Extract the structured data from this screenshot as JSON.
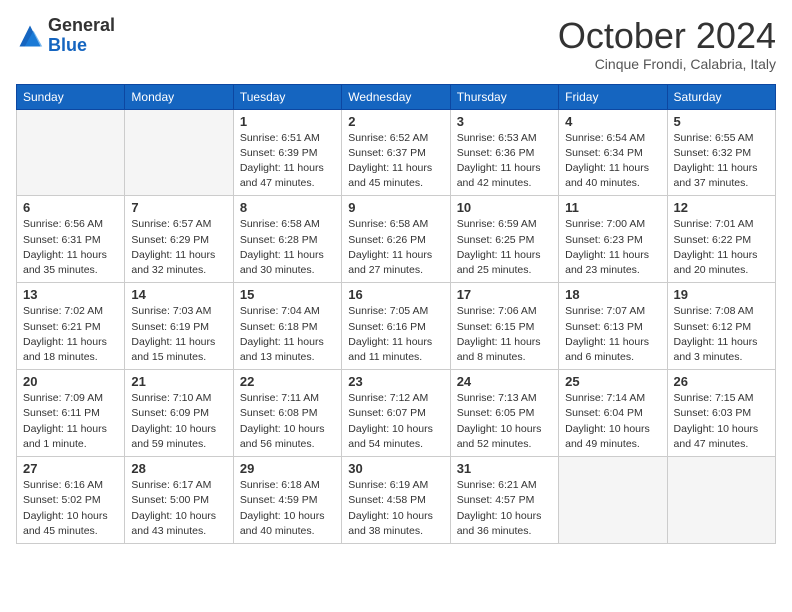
{
  "logo": {
    "line1": "General",
    "line2": "Blue"
  },
  "header": {
    "month": "October 2024",
    "location": "Cinque Frondi, Calabria, Italy"
  },
  "weekdays": [
    "Sunday",
    "Monday",
    "Tuesday",
    "Wednesday",
    "Thursday",
    "Friday",
    "Saturday"
  ],
  "weeks": [
    [
      {
        "day": "",
        "info": ""
      },
      {
        "day": "",
        "info": ""
      },
      {
        "day": "1",
        "info": "Sunrise: 6:51 AM\nSunset: 6:39 PM\nDaylight: 11 hours and 47 minutes."
      },
      {
        "day": "2",
        "info": "Sunrise: 6:52 AM\nSunset: 6:37 PM\nDaylight: 11 hours and 45 minutes."
      },
      {
        "day": "3",
        "info": "Sunrise: 6:53 AM\nSunset: 6:36 PM\nDaylight: 11 hours and 42 minutes."
      },
      {
        "day": "4",
        "info": "Sunrise: 6:54 AM\nSunset: 6:34 PM\nDaylight: 11 hours and 40 minutes."
      },
      {
        "day": "5",
        "info": "Sunrise: 6:55 AM\nSunset: 6:32 PM\nDaylight: 11 hours and 37 minutes."
      }
    ],
    [
      {
        "day": "6",
        "info": "Sunrise: 6:56 AM\nSunset: 6:31 PM\nDaylight: 11 hours and 35 minutes."
      },
      {
        "day": "7",
        "info": "Sunrise: 6:57 AM\nSunset: 6:29 PM\nDaylight: 11 hours and 32 minutes."
      },
      {
        "day": "8",
        "info": "Sunrise: 6:58 AM\nSunset: 6:28 PM\nDaylight: 11 hours and 30 minutes."
      },
      {
        "day": "9",
        "info": "Sunrise: 6:58 AM\nSunset: 6:26 PM\nDaylight: 11 hours and 27 minutes."
      },
      {
        "day": "10",
        "info": "Sunrise: 6:59 AM\nSunset: 6:25 PM\nDaylight: 11 hours and 25 minutes."
      },
      {
        "day": "11",
        "info": "Sunrise: 7:00 AM\nSunset: 6:23 PM\nDaylight: 11 hours and 23 minutes."
      },
      {
        "day": "12",
        "info": "Sunrise: 7:01 AM\nSunset: 6:22 PM\nDaylight: 11 hours and 20 minutes."
      }
    ],
    [
      {
        "day": "13",
        "info": "Sunrise: 7:02 AM\nSunset: 6:21 PM\nDaylight: 11 hours and 18 minutes."
      },
      {
        "day": "14",
        "info": "Sunrise: 7:03 AM\nSunset: 6:19 PM\nDaylight: 11 hours and 15 minutes."
      },
      {
        "day": "15",
        "info": "Sunrise: 7:04 AM\nSunset: 6:18 PM\nDaylight: 11 hours and 13 minutes."
      },
      {
        "day": "16",
        "info": "Sunrise: 7:05 AM\nSunset: 6:16 PM\nDaylight: 11 hours and 11 minutes."
      },
      {
        "day": "17",
        "info": "Sunrise: 7:06 AM\nSunset: 6:15 PM\nDaylight: 11 hours and 8 minutes."
      },
      {
        "day": "18",
        "info": "Sunrise: 7:07 AM\nSunset: 6:13 PM\nDaylight: 11 hours and 6 minutes."
      },
      {
        "day": "19",
        "info": "Sunrise: 7:08 AM\nSunset: 6:12 PM\nDaylight: 11 hours and 3 minutes."
      }
    ],
    [
      {
        "day": "20",
        "info": "Sunrise: 7:09 AM\nSunset: 6:11 PM\nDaylight: 11 hours and 1 minute."
      },
      {
        "day": "21",
        "info": "Sunrise: 7:10 AM\nSunset: 6:09 PM\nDaylight: 10 hours and 59 minutes."
      },
      {
        "day": "22",
        "info": "Sunrise: 7:11 AM\nSunset: 6:08 PM\nDaylight: 10 hours and 56 minutes."
      },
      {
        "day": "23",
        "info": "Sunrise: 7:12 AM\nSunset: 6:07 PM\nDaylight: 10 hours and 54 minutes."
      },
      {
        "day": "24",
        "info": "Sunrise: 7:13 AM\nSunset: 6:05 PM\nDaylight: 10 hours and 52 minutes."
      },
      {
        "day": "25",
        "info": "Sunrise: 7:14 AM\nSunset: 6:04 PM\nDaylight: 10 hours and 49 minutes."
      },
      {
        "day": "26",
        "info": "Sunrise: 7:15 AM\nSunset: 6:03 PM\nDaylight: 10 hours and 47 minutes."
      }
    ],
    [
      {
        "day": "27",
        "info": "Sunrise: 6:16 AM\nSunset: 5:02 PM\nDaylight: 10 hours and 45 minutes."
      },
      {
        "day": "28",
        "info": "Sunrise: 6:17 AM\nSunset: 5:00 PM\nDaylight: 10 hours and 43 minutes."
      },
      {
        "day": "29",
        "info": "Sunrise: 6:18 AM\nSunset: 4:59 PM\nDaylight: 10 hours and 40 minutes."
      },
      {
        "day": "30",
        "info": "Sunrise: 6:19 AM\nSunset: 4:58 PM\nDaylight: 10 hours and 38 minutes."
      },
      {
        "day": "31",
        "info": "Sunrise: 6:21 AM\nSunset: 4:57 PM\nDaylight: 10 hours and 36 minutes."
      },
      {
        "day": "",
        "info": ""
      },
      {
        "day": "",
        "info": ""
      }
    ]
  ]
}
